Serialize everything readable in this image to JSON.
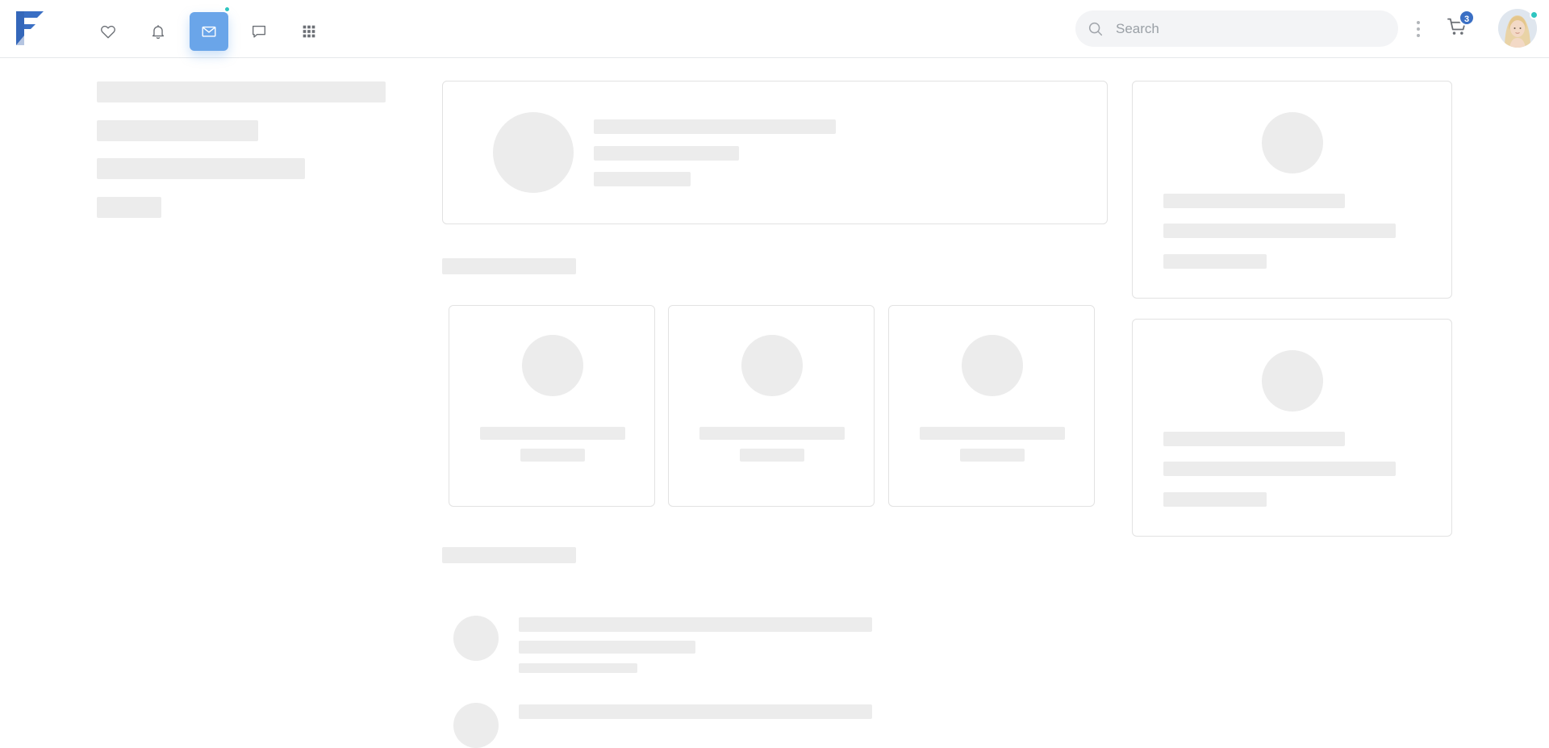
{
  "header": {
    "search": {
      "placeholder": "Search",
      "value": ""
    },
    "cart": {
      "count": "3"
    },
    "nav": [
      {
        "name": "favorites",
        "icon": "heart-icon",
        "active": false
      },
      {
        "name": "notifications",
        "icon": "bell-icon",
        "active": false
      },
      {
        "name": "messages",
        "icon": "envelope-icon",
        "active": true,
        "has_dot": true
      },
      {
        "name": "chat",
        "icon": "chat-bubble-icon",
        "active": false
      },
      {
        "name": "apps",
        "icon": "grid-icon",
        "active": false
      }
    ]
  },
  "colors": {
    "brand": "#3a6fc4",
    "active_nav": "#6aa5e9",
    "online_dot": "#2ec5c0",
    "skeleton": "#ececec",
    "card_border": "#e2e2e2"
  },
  "state": "loading-skeleton"
}
